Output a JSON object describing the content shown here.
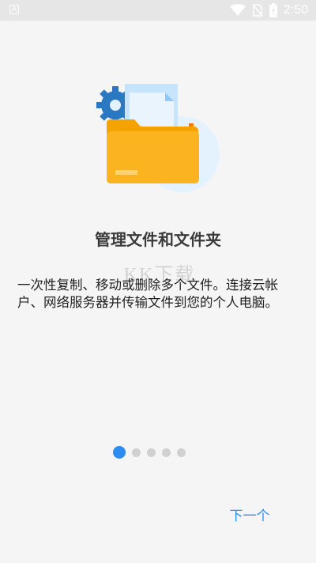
{
  "status_bar": {
    "time": "2:50",
    "left_icon": "app-notification-icon",
    "icons": [
      "wifi-icon",
      "no-sim-icon",
      "battery-charging-icon"
    ]
  },
  "onboarding": {
    "title": "管理文件和文件夹",
    "description": "一次性复制、移动或删除多个文件。连接云帐户、网络服务器并传输文件到您的个人电脑。",
    "watermark": "KK下载",
    "page_indicator": {
      "total": 5,
      "current": 1
    },
    "next_label": "下一个"
  },
  "colors": {
    "accent": "#2d8cf0",
    "folder": "#fbb41f",
    "gear": "#2b78c2",
    "circle_bg": "#e3f2fd"
  }
}
